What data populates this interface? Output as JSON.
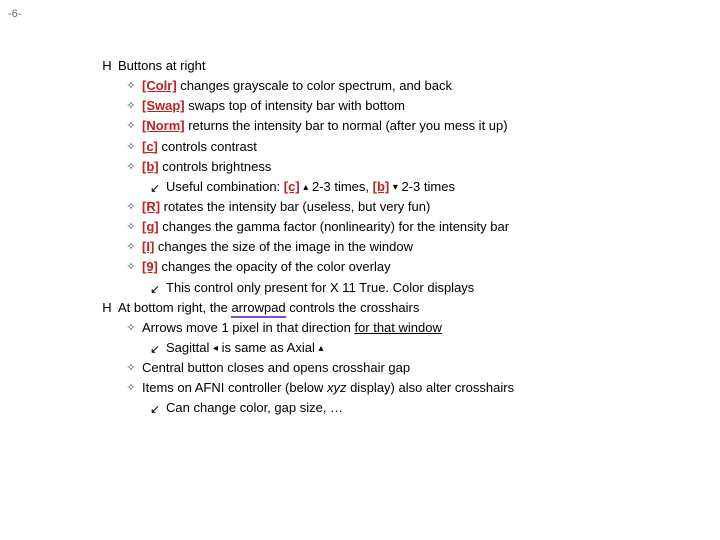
{
  "page_number": "-6-",
  "bullets": {
    "lvl0": "H",
    "lvl1": "✧",
    "lvl2": "↙"
  },
  "s1": {
    "heading": "Buttons at right",
    "items": [
      {
        "btn": "[Colr]",
        "desc": " changes grayscale to color spectrum, and back"
      },
      {
        "btn": "[Swap]",
        "desc": " swaps top of intensity bar with bottom"
      },
      {
        "btn": "[Norm]",
        "desc": " returns the intensity bar to normal (after you mess it up)"
      },
      {
        "btn": "[c]",
        "desc": " controls contrast"
      },
      {
        "btn": "[b]",
        "desc": " controls brightness"
      }
    ],
    "combo": {
      "lead": "Useful combination: ",
      "c": "[c]",
      "up": "▴",
      "mid": " 2-3 times, ",
      "b": "[b]",
      "down": "▾",
      "tail": " 2-3 times"
    },
    "items2": [
      {
        "btn": "[R]",
        "desc": " rotates the intensity bar (useless, but very fun)"
      },
      {
        "btn": "[g]",
        "desc": " changes the gamma factor (nonlinearity) for the intensity bar"
      },
      {
        "btn": "[I]",
        "desc": " changes the size of the image in the window"
      },
      {
        "btn": "[9]",
        "desc": " changes the opacity of the color overlay"
      }
    ],
    "note9": {
      "lead": "This control only present for X 11 True",
      "dot": ". ",
      "tail": "Color displays"
    }
  },
  "s2": {
    "lead": "At bottom right, the ",
    "arrowpad": "arrowpad",
    "tail": " controls the crosshairs",
    "l1": {
      "lead": "Arrows move 1 pixel in that direction ",
      "ul": "for that window"
    },
    "l2": {
      "lead": "Sagittal ",
      "left": "◂",
      "mid": " is same as Axial ",
      "up": "▴"
    },
    "l3": "Central button closes and opens crosshair gap",
    "l4": {
      "lead": "Items on AFNI controller (below ",
      "xyz": "xyz",
      "tail": " display) also alter crosshairs"
    },
    "l5": "Can change color, gap size, …"
  }
}
